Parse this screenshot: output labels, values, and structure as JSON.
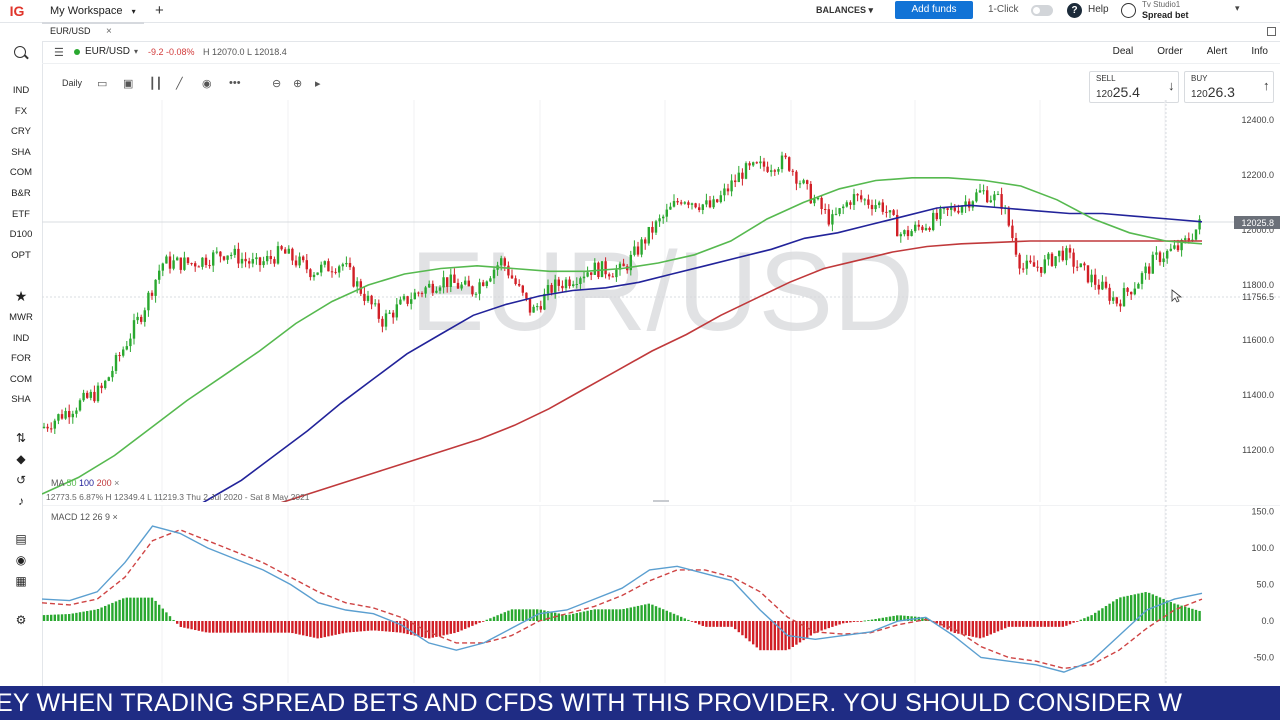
{
  "topbar": {
    "logo": "IG",
    "workspace": "My Workspace",
    "workspace_chevron": "▾",
    "add_tab": "+",
    "balances": "BALANCES ▾",
    "add_funds": "Add funds",
    "one_click": "1-Click",
    "help": "Help",
    "user_line1": "Tv Studio1",
    "user_line2": "Spread bet",
    "user_chevron": "▾"
  },
  "tab": {
    "label": "EUR/USD",
    "close": "×"
  },
  "sidebar": {
    "markets": [
      "IND",
      "FX",
      "CRY",
      "SHA",
      "COM",
      "B&R",
      "ETF",
      "D100",
      "OPT"
    ],
    "watchlists": [
      "MWR",
      "IND",
      "FOR",
      "COM",
      "SHA"
    ]
  },
  "instrument": {
    "name": "EUR/USD",
    "chevron": "▾",
    "change": "-9.2  -0.08%",
    "hl": "H 12070.0  L 12018.4",
    "links": [
      "Deal",
      "Order",
      "Alert",
      "Info"
    ]
  },
  "toolbar": {
    "interval": "Daily"
  },
  "prices": {
    "sell_label": "SELL",
    "sell_prefix": "120",
    "sell_big": "25.4",
    "buy_label": "BUY",
    "buy_prefix": "120",
    "buy_big": "26.3"
  },
  "colors": {
    "up": "#2aa830",
    "down": "#d11f26",
    "ma50": "#56b94f",
    "ma100": "#22239a",
    "ma200": "#c0393b",
    "macd": "#5b9fd0",
    "signal": "#cf4444",
    "ticker_bg": "#1f2c84"
  },
  "chart_data": {
    "type": "candlestick",
    "watermark": "EUR/USD",
    "yticks": [
      "12400.0",
      "12200.0",
      "12000.0",
      "11800.0",
      "11600.0",
      "11400.0",
      "11200.0"
    ],
    "last_price_label": "12025.8",
    "crosshair_price_label": "11756.5",
    "ma_legend": {
      "label": "MA",
      "periods": [
        "50",
        "100",
        "200"
      ],
      "close": "×"
    },
    "info_line": {
      "open": "12773.5",
      "change": "6.87%",
      "high": "H 12349.4",
      "low": "L 11219.3",
      "range": "Thu 2 Jul 2020 - Sat 8 May 2021"
    },
    "ma50": [
      11040,
      11100,
      11180,
      11280,
      11380,
      11470,
      11560,
      11660,
      11740,
      11800,
      11840,
      11860,
      11870,
      11860,
      11850,
      11850,
      11860,
      11880,
      11910,
      11960,
      12040,
      12100,
      12150,
      12180,
      12190,
      12190,
      12180,
      12160,
      12110,
      12040,
      11990,
      11960,
      11950
    ],
    "ma100": [
      10900,
      10950,
      11020,
      11090,
      11180,
      11270,
      11370,
      11460,
      11550,
      11620,
      11690,
      11730,
      11760,
      11780,
      11790,
      11810,
      11840,
      11870,
      11900,
      11930,
      11970,
      11990,
      12020,
      12050,
      12080,
      12090,
      12080,
      12070,
      12060,
      12060,
      12050,
      12040,
      12030
    ],
    "ma200": [
      10850,
      10870,
      10900,
      10930,
      10960,
      11000,
      11040,
      11080,
      11120,
      11160,
      11200,
      11240,
      11290,
      11350,
      11420,
      11490,
      11560,
      11620,
      11690,
      11750,
      11810,
      11860,
      11890,
      11920,
      11940,
      11950,
      11955,
      11960,
      11960,
      11960,
      11960,
      11960,
      11960
    ]
  },
  "macd_data": {
    "legend": {
      "label": "MACD",
      "params": [
        "12",
        "26",
        "9"
      ],
      "close": "×"
    },
    "yticks": [
      "150.0",
      "100.0",
      "50.0",
      "0.0",
      "-50.0"
    ],
    "macd": [
      30,
      28,
      40,
      80,
      130,
      120,
      100,
      85,
      70,
      50,
      25,
      15,
      10,
      -5,
      -30,
      -40,
      -30,
      -10,
      10,
      15,
      30,
      45,
      70,
      75,
      65,
      55,
      15,
      -20,
      -25,
      -20,
      -15,
      0,
      5,
      -20,
      -50,
      -55,
      -60,
      -70,
      -55,
      -20,
      15,
      30,
      38
    ],
    "signal": [
      25,
      22,
      30,
      60,
      110,
      125,
      110,
      95,
      80,
      60,
      40,
      25,
      18,
      5,
      -15,
      -30,
      -30,
      -20,
      0,
      10,
      20,
      35,
      55,
      70,
      70,
      60,
      40,
      5,
      -15,
      -18,
      -16,
      -5,
      2,
      -10,
      -35,
      -50,
      -55,
      -65,
      -60,
      -40,
      -10,
      15,
      30
    ]
  },
  "ticker": "EY WHEN TRADING SPREAD BETS AND CFDS WITH THIS PROVIDER. YOU SHOULD CONSIDER W"
}
